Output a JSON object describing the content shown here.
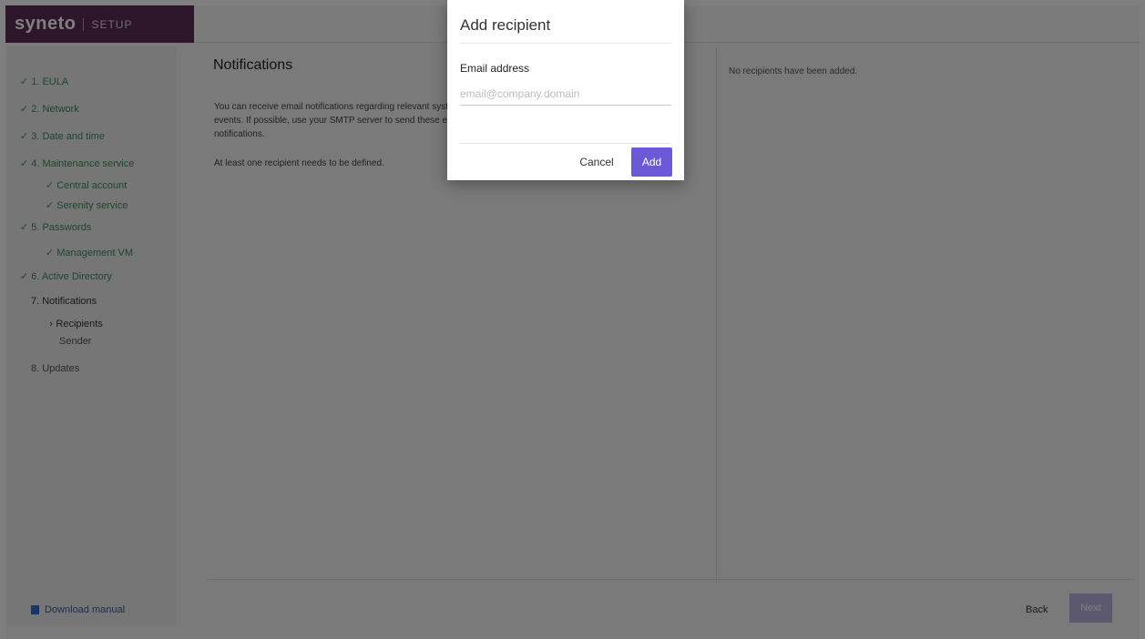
{
  "brand": {
    "name": "syneto",
    "subtitle": "SETUP",
    "color": "#5b2c52"
  },
  "sidebar": {
    "items": [
      {
        "label": "1. EULA",
        "status": "done"
      },
      {
        "label": "2. Network",
        "status": "done"
      },
      {
        "label": "3. Date and time",
        "status": "done"
      },
      {
        "label": "4. Maintenance service",
        "status": "done"
      },
      {
        "label": "Central account",
        "status": "done",
        "level": 1
      },
      {
        "label": "Serenity service",
        "status": "done",
        "level": 1
      },
      {
        "label": "5. Passwords",
        "status": "done"
      },
      {
        "label": "Management VM",
        "status": "done",
        "level": 1
      },
      {
        "label": "6. Active Directory",
        "status": "done"
      },
      {
        "label": "7. Notifications",
        "status": "current"
      },
      {
        "label": "Recipients",
        "status": "current",
        "level": 2
      },
      {
        "label": "Sender",
        "status": "pending",
        "level": 2
      },
      {
        "label": "8. Updates",
        "status": "pending"
      }
    ],
    "check_glyph": "✓",
    "current_glyph": "›",
    "manual_label": "Download manual"
  },
  "main": {
    "title": "Notifications",
    "description": "You can receive email notifications regarding relevant system events. If possible, use your SMTP server to send these email notifications.",
    "requirement": "At least one recipient needs to be defined.",
    "no_recipients": "No recipients have been added."
  },
  "footer": {
    "back_label": "Back",
    "next_label": "Next"
  },
  "modal": {
    "title": "Add recipient",
    "email_label": "Email address",
    "email_placeholder": "email@company.domain",
    "email_value": "",
    "cancel_label": "Cancel",
    "add_label": "Add",
    "accent_color": "#6a5ad8"
  }
}
